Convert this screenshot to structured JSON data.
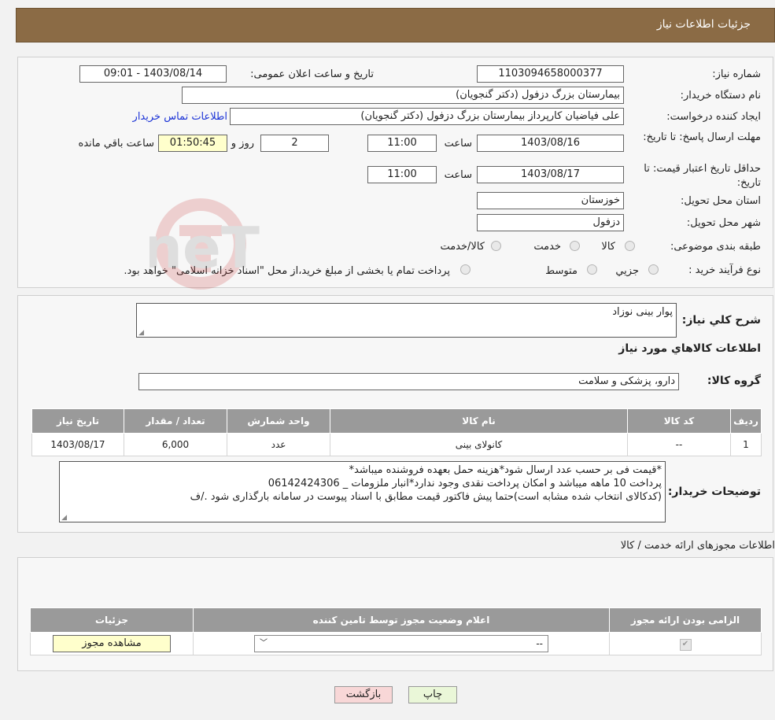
{
  "header": {
    "title": "جزئیات اطلاعات نیاز"
  },
  "form": {
    "need_number_label": "شماره نیاز:",
    "need_number": "1103094658000377",
    "announce_label": "تاریخ و ساعت اعلان عمومی:",
    "announce_value": "1403/08/14 - 09:01",
    "buyer_org_label": "نام دستگاه خریدار:",
    "buyer_org": "بیمارستان بزرگ دزفول (دکتر گنجویان)",
    "requester_label": "ایجاد کننده درخواست:",
    "requester": "علی فیاضیان کارپرداز بیمارستان بزرگ دزفول (دکتر گنجویان)",
    "contact_link": "اطلاعات تماس خریدار",
    "reply_deadline_label": "مهلت ارسال پاسخ: تا تاریخ:",
    "reply_date": "1403/08/16",
    "time_label": "ساعت",
    "reply_time": "11:00",
    "days_value": "2",
    "days_label": "روز و",
    "remaining_value": "01:50:45",
    "remaining_label": "ساعت باقي مانده",
    "price_validity_label": "حداقل تاریخ اعتبار قیمت: تا تاریخ:",
    "price_date": "1403/08/17",
    "price_time": "11:00",
    "province_label": "استان محل تحویل:",
    "province": "خوزستان",
    "city_label": "شهر محل تحویل:",
    "city": "دزفول",
    "category_label": "طبقه بندی موضوعی:",
    "category_options": [
      "کالا",
      "خدمت",
      "کالا/خدمت"
    ],
    "process_label": "نوع فرآیند خرید :",
    "process_options": [
      "جزیي",
      "متوسط"
    ],
    "process_note": "پرداخت تمام یا بخشی از مبلغ خرید،از محل \"اسناد خزانه اسلامی\" خواهد بود."
  },
  "details": {
    "summary_label": "شرح کلي نياز:",
    "summary": "پوار بینی نوزاد",
    "goods_info_title": "اطلاعات کالاهاي مورد نياز",
    "group_label": "گروه کالا:",
    "group_value": "دارو، پزشکی و سلامت",
    "table": {
      "headers": [
        "رديف",
        "کد کالا",
        "نام کالا",
        "واحد شمارش",
        "تعداد / مقدار",
        "تاریخ نیاز"
      ],
      "rows": [
        [
          "1",
          "--",
          "کانولای بینی",
          "عدد",
          "6,000",
          "1403/08/17"
        ]
      ]
    },
    "notes_label": "توضیحات خریدار:",
    "notes": [
      "*قیمت فی بر حسب عدد ارسال شود*هزینه حمل بعهده فروشنده میباشد*",
      "پرداخت 10 ماهه میباشد و امکان پرداخت نقدی وجود ندارد*انبار ملزومات _ 06142424306",
      "(کدکالای انتخاب شده مشابه است)حتما پیش فاکتور قیمت مطابق با اسناد پیوست در سامانه بارگذاری شود ./ف"
    ]
  },
  "licenses": {
    "title": "اطلاعات مجوزهای ارائه خدمت / کالا",
    "headers": [
      "الزامی بودن ارائه مجوز",
      "اعلام وضعیت مجوز توسط تامین کننده",
      "جزئیات"
    ],
    "select_value": "--",
    "view_button": "مشاهده مجوز"
  },
  "buttons": {
    "print": "چاپ",
    "back": "بازگشت"
  },
  "watermark": "AriaTender.neT",
  "colors": {
    "header": "#8b6b45",
    "table_header": "#9a9a9a",
    "link": "#1a32d6",
    "back_button": "#f8d7d7",
    "print_button": "#eaf7d8",
    "timer": "#ffffcc"
  }
}
